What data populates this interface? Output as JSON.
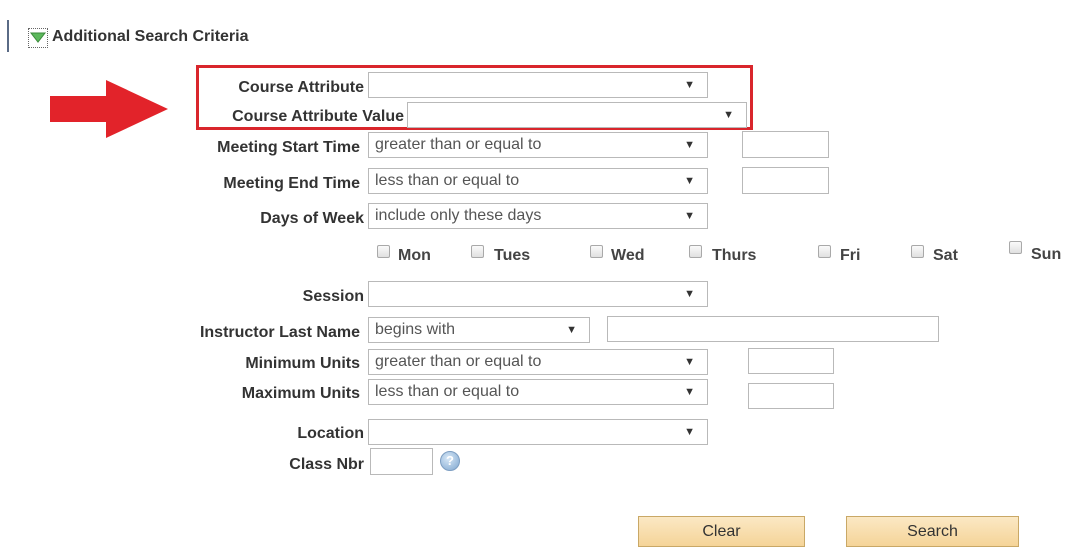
{
  "section": {
    "title": "Additional Search Criteria"
  },
  "icons": {
    "toggle": "triangle-down-icon",
    "arrow": "red-arrow-icon",
    "help": "question-icon"
  },
  "colors": {
    "highlight": "#d9262c",
    "arrow": "#e2232a",
    "button": "#f5d498",
    "toggle": "#5cb85c"
  },
  "fields": {
    "course_attribute": {
      "label": "Course Attribute",
      "value": ""
    },
    "course_attribute_value": {
      "label": "Course Attribute Value",
      "value": ""
    },
    "meeting_start_time": {
      "label": "Meeting Start Time",
      "operator": "greater than or equal to",
      "value": ""
    },
    "meeting_end_time": {
      "label": "Meeting End Time",
      "operator": "less than or equal to",
      "value": ""
    },
    "days_of_week": {
      "label": "Days of Week",
      "operator": "include only these days",
      "days": [
        "Mon",
        "Tues",
        "Wed",
        "Thurs",
        "Fri",
        "Sat",
        "Sun"
      ]
    },
    "session": {
      "label": "Session",
      "value": ""
    },
    "instructor_last_name": {
      "label": "Instructor Last Name",
      "operator": "begins with",
      "value": ""
    },
    "minimum_units": {
      "label": "Minimum Units",
      "operator": "greater than or equal to",
      "value": ""
    },
    "maximum_units": {
      "label": "Maximum Units",
      "operator": "less than or equal to",
      "value": ""
    },
    "location": {
      "label": "Location",
      "value": ""
    },
    "class_nbr": {
      "label": "Class Nbr",
      "value": ""
    }
  },
  "buttons": {
    "clear": "Clear",
    "search": "Search"
  }
}
